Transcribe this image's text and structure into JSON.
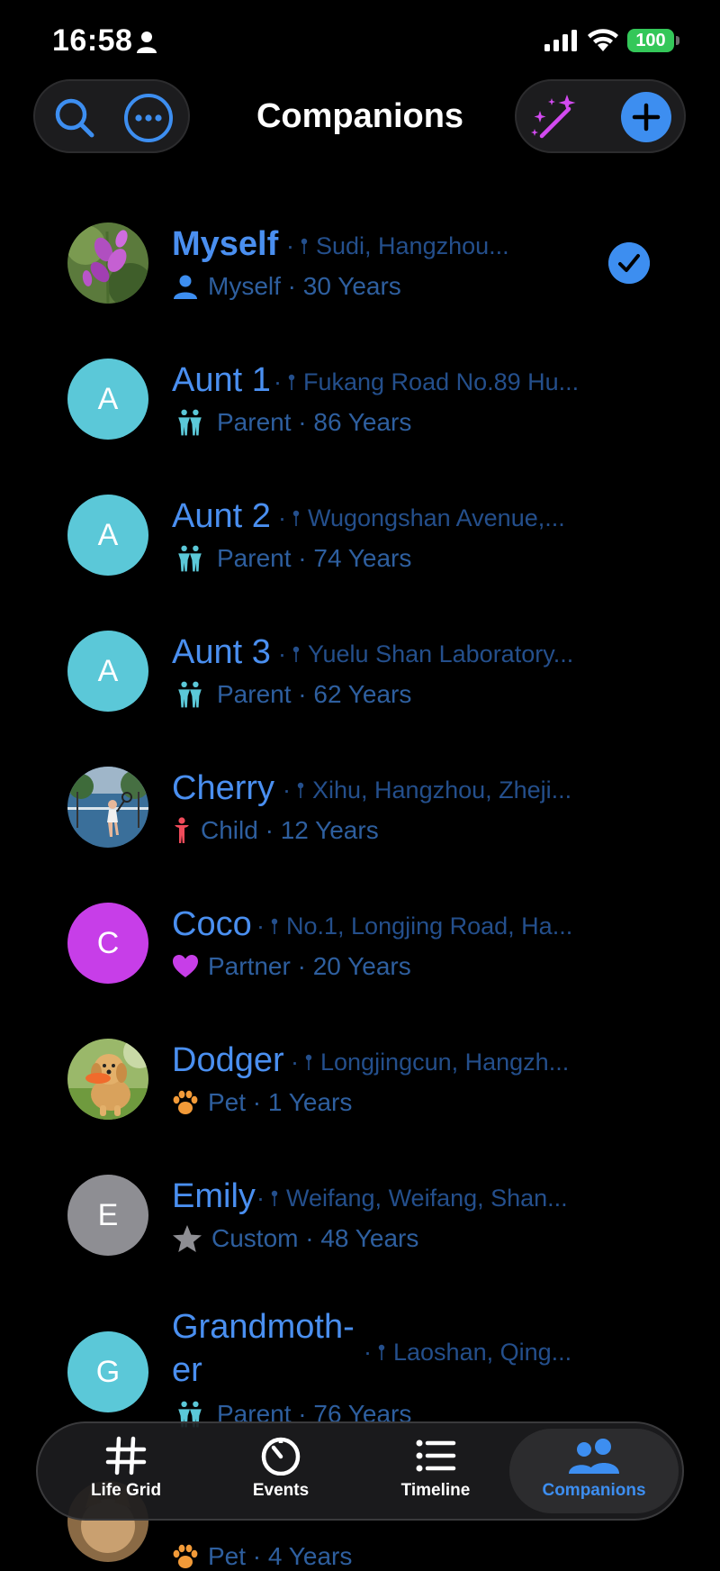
{
  "status_bar": {
    "time": "16:58",
    "battery": "100"
  },
  "header": {
    "title": "Companions",
    "icons": [
      "search-icon",
      "more-icon",
      "magic-wand-icon",
      "plus-icon"
    ]
  },
  "colors": {
    "accent": "#3d8ef0",
    "name": "#4a8ff0",
    "subtext": "#2e5f9f",
    "location": "#244f8c",
    "teal_avatar": "#5bc8d8",
    "purple_avatar": "#c73ee8",
    "gray_avatar": "#8e8e93"
  },
  "companions": [
    {
      "name": "Myself",
      "location": "Sudi, Hangzhou...",
      "relation": "Myself",
      "age": "30 Years",
      "icon": "person-icon",
      "selected": true,
      "avatar": "photo-flowers"
    },
    {
      "name": "Aunt 1",
      "location": "Fukang Road No.89 Hu...",
      "relation": "Parent",
      "age": "86 Years",
      "icon": "parents-icon",
      "initial": "A"
    },
    {
      "name": "Aunt 2",
      "location": "Wugongshan Avenue,...",
      "relation": "Parent",
      "age": "74 Years",
      "icon": "parents-icon",
      "initial": "A"
    },
    {
      "name": "Aunt 3",
      "location": "Yuelu Shan Laboratory...",
      "relation": "Parent",
      "age": "62 Years",
      "icon": "parents-icon",
      "initial": "A"
    },
    {
      "name": "Cherry",
      "location": "Xihu, Hangzhou, Zheji...",
      "relation": "Child",
      "age": "12 Years",
      "icon": "child-icon",
      "avatar": "photo-tennis"
    },
    {
      "name": "Coco",
      "location": "No.1, Longjing Road, Ha...",
      "relation": "Partner",
      "age": "20 Years",
      "icon": "heart-icon",
      "initial": "C"
    },
    {
      "name": "Dodger",
      "location": "Longjingcun, Hangzh...",
      "relation": "Pet",
      "age": "1 Years",
      "icon": "paw-icon",
      "avatar": "photo-dog"
    },
    {
      "name": "Emily",
      "location": "Weifang, Weifang, Shan...",
      "relation": "Custom",
      "age": "48 Years",
      "icon": "star-icon",
      "initial": "E"
    },
    {
      "name_line1": "Grandmoth-",
      "name_line2": "er",
      "location": "Laoshan, Qing...",
      "relation": "Parent",
      "age": "76 Years",
      "icon": "parents-icon",
      "initial": "G"
    },
    {
      "relation": "Pet",
      "age": "4 Years",
      "icon": "paw-icon",
      "avatar": "photo-cat"
    }
  ],
  "tabs": [
    {
      "label": "Life Grid",
      "icon": "grid-icon"
    },
    {
      "label": "Events",
      "icon": "timer-icon"
    },
    {
      "label": "Timeline",
      "icon": "list-icon"
    },
    {
      "label": "Companions",
      "icon": "people-icon",
      "active": true
    }
  ]
}
